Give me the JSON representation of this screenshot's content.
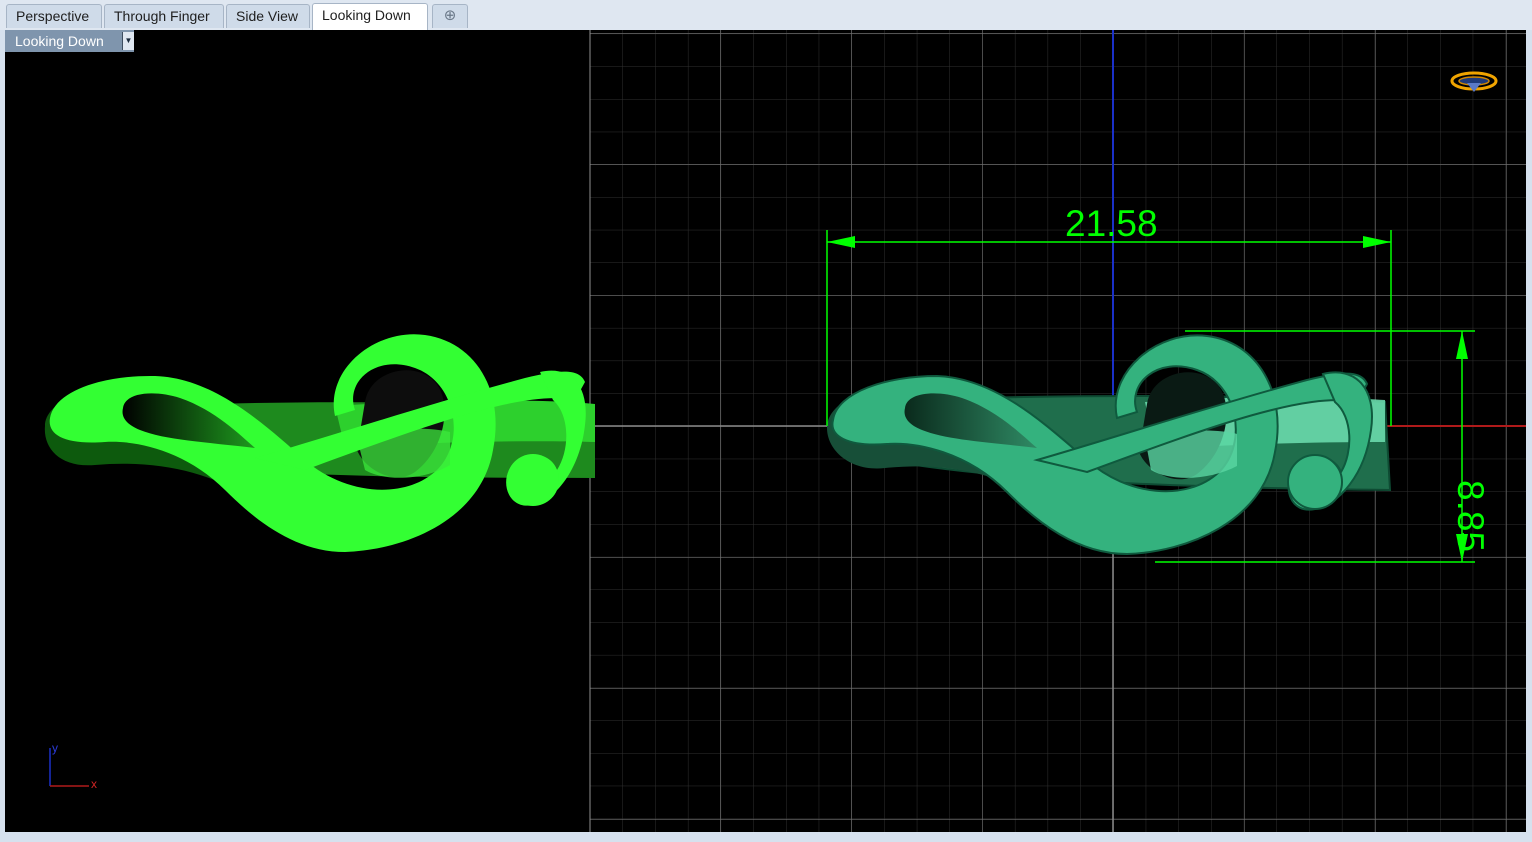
{
  "tabs": [
    {
      "label": "Perspective",
      "active": false
    },
    {
      "label": "Through Finger",
      "active": false
    },
    {
      "label": "Side View",
      "active": false
    },
    {
      "label": "Looking Down",
      "active": true
    }
  ],
  "add_tab_glyph": "⊕",
  "viewport": {
    "label": "Looking Down",
    "dropdown_glyph": "▼"
  },
  "dimensions": {
    "width": "21.58",
    "height": "8.85"
  },
  "axis_indicator": {
    "x": "x",
    "y": "y"
  },
  "colors": {
    "render_green": "#33ff33",
    "shaded_green": "#34b27e",
    "dimension": "#00ff00",
    "grid_minor": "#2e2e2e",
    "grid_major": "#6a6a6a",
    "x_axis": "#b01a1a",
    "y_axis": "#1a30c8",
    "label_bg": "#7f95ad"
  },
  "icons": [
    "add-tab-icon",
    "dropdown-arrow-icon",
    "world-axes-icon",
    "axis-indicator-icon"
  ]
}
